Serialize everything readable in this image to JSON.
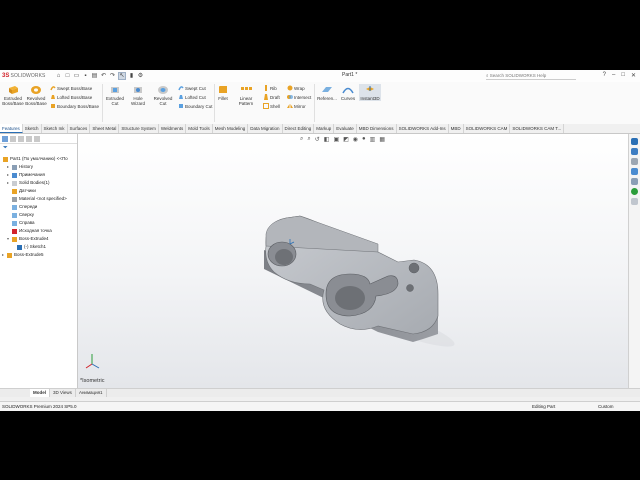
{
  "app": {
    "logo_ds": "3S",
    "logo_text": "SOLIDWORKS",
    "document_title": "Part1 *",
    "search_placeholder": "Search SOLIDWORKS Help",
    "window_controls": [
      "?",
      "–",
      "□",
      "✕"
    ]
  },
  "ribbon": {
    "extruded_boss": "Extruded Boss/Base",
    "revolved_boss": "Revolved Boss/Base",
    "swept_boss": "Swept Boss/Base",
    "lofted_boss": "Lofted Boss/Base",
    "boundary_boss": "Boundary Boss/Base",
    "extruded_cut": "Extruded Cut",
    "hole_wizard": "Hole Wizard",
    "revolved_cut": "Revolved Cut",
    "swept_cut": "Swept Cut",
    "lofted_cut": "Lofted Cut",
    "boundary_cut": "Boundary Cut",
    "fillet": "Fillet",
    "linear_pattern": "Linear Pattern",
    "rib": "Rib",
    "draft": "Draft",
    "shell": "Shell",
    "wrap": "Wrap",
    "intersect": "Intersect",
    "mirror": "Mirror",
    "reference": "Referen...",
    "curves": "Curves",
    "instant3d": "Instant3D"
  },
  "command_tabs": [
    "Features",
    "Sketch",
    "Sketch Ink",
    "Surfaces",
    "Sheet Metal",
    "Structure System",
    "Weldments",
    "Mold Tools",
    "Mesh Modeling",
    "Data Migration",
    "Direct Editing",
    "Markup",
    "Evaluate",
    "MBD Dimensions",
    "SOLIDWORKS Add-Ins",
    "MBD",
    "SOLIDWORKS CAM",
    "SOLIDWORKS CAM T..."
  ],
  "feature_tree": {
    "part": "Part1 (По умолчанию) <<По",
    "items": [
      {
        "label": "History",
        "indent": 1,
        "expand": "▸",
        "icon": "history-icon"
      },
      {
        "label": "Примечания",
        "indent": 1,
        "expand": "▸",
        "icon": "annotations-icon"
      },
      {
        "label": "Solid Bodies(1)",
        "indent": 1,
        "expand": "▸",
        "icon": "solid-bodies-icon"
      },
      {
        "label": "Датчики",
        "indent": 1,
        "expand": "",
        "icon": "sensors-icon"
      },
      {
        "label": "Material <not specified>",
        "indent": 1,
        "expand": "",
        "icon": "material-icon"
      },
      {
        "label": "Спереди",
        "indent": 1,
        "expand": "",
        "icon": "plane-icon"
      },
      {
        "label": "Сверху",
        "indent": 1,
        "expand": "",
        "icon": "plane-icon"
      },
      {
        "label": "Справа",
        "indent": 1,
        "expand": "",
        "icon": "plane-icon"
      },
      {
        "label": "Исходная точка",
        "indent": 1,
        "expand": "",
        "icon": "origin-icon"
      },
      {
        "label": "Boss-Extrude4",
        "indent": 1,
        "expand": "▾",
        "icon": "extrude-icon"
      },
      {
        "label": "(-) Sketch1",
        "indent": 2,
        "expand": "",
        "icon": "sketch-icon"
      },
      {
        "label": "Boss-Extrude5",
        "indent": 0,
        "expand": "▸",
        "icon": "extrude-icon"
      }
    ]
  },
  "viewport": {
    "view_label": "*Isometric"
  },
  "bottom_tabs": [
    "Model",
    "3D Views",
    "Анимация1"
  ],
  "status": {
    "product": "SOLIDWORKS Premium 2024 SP5.0",
    "mode": "Editing Part",
    "units": "Custom"
  },
  "colors": {
    "part_top": "#b9bcc1",
    "part_side": "#8d9096",
    "accent": "#2a6fb5"
  }
}
